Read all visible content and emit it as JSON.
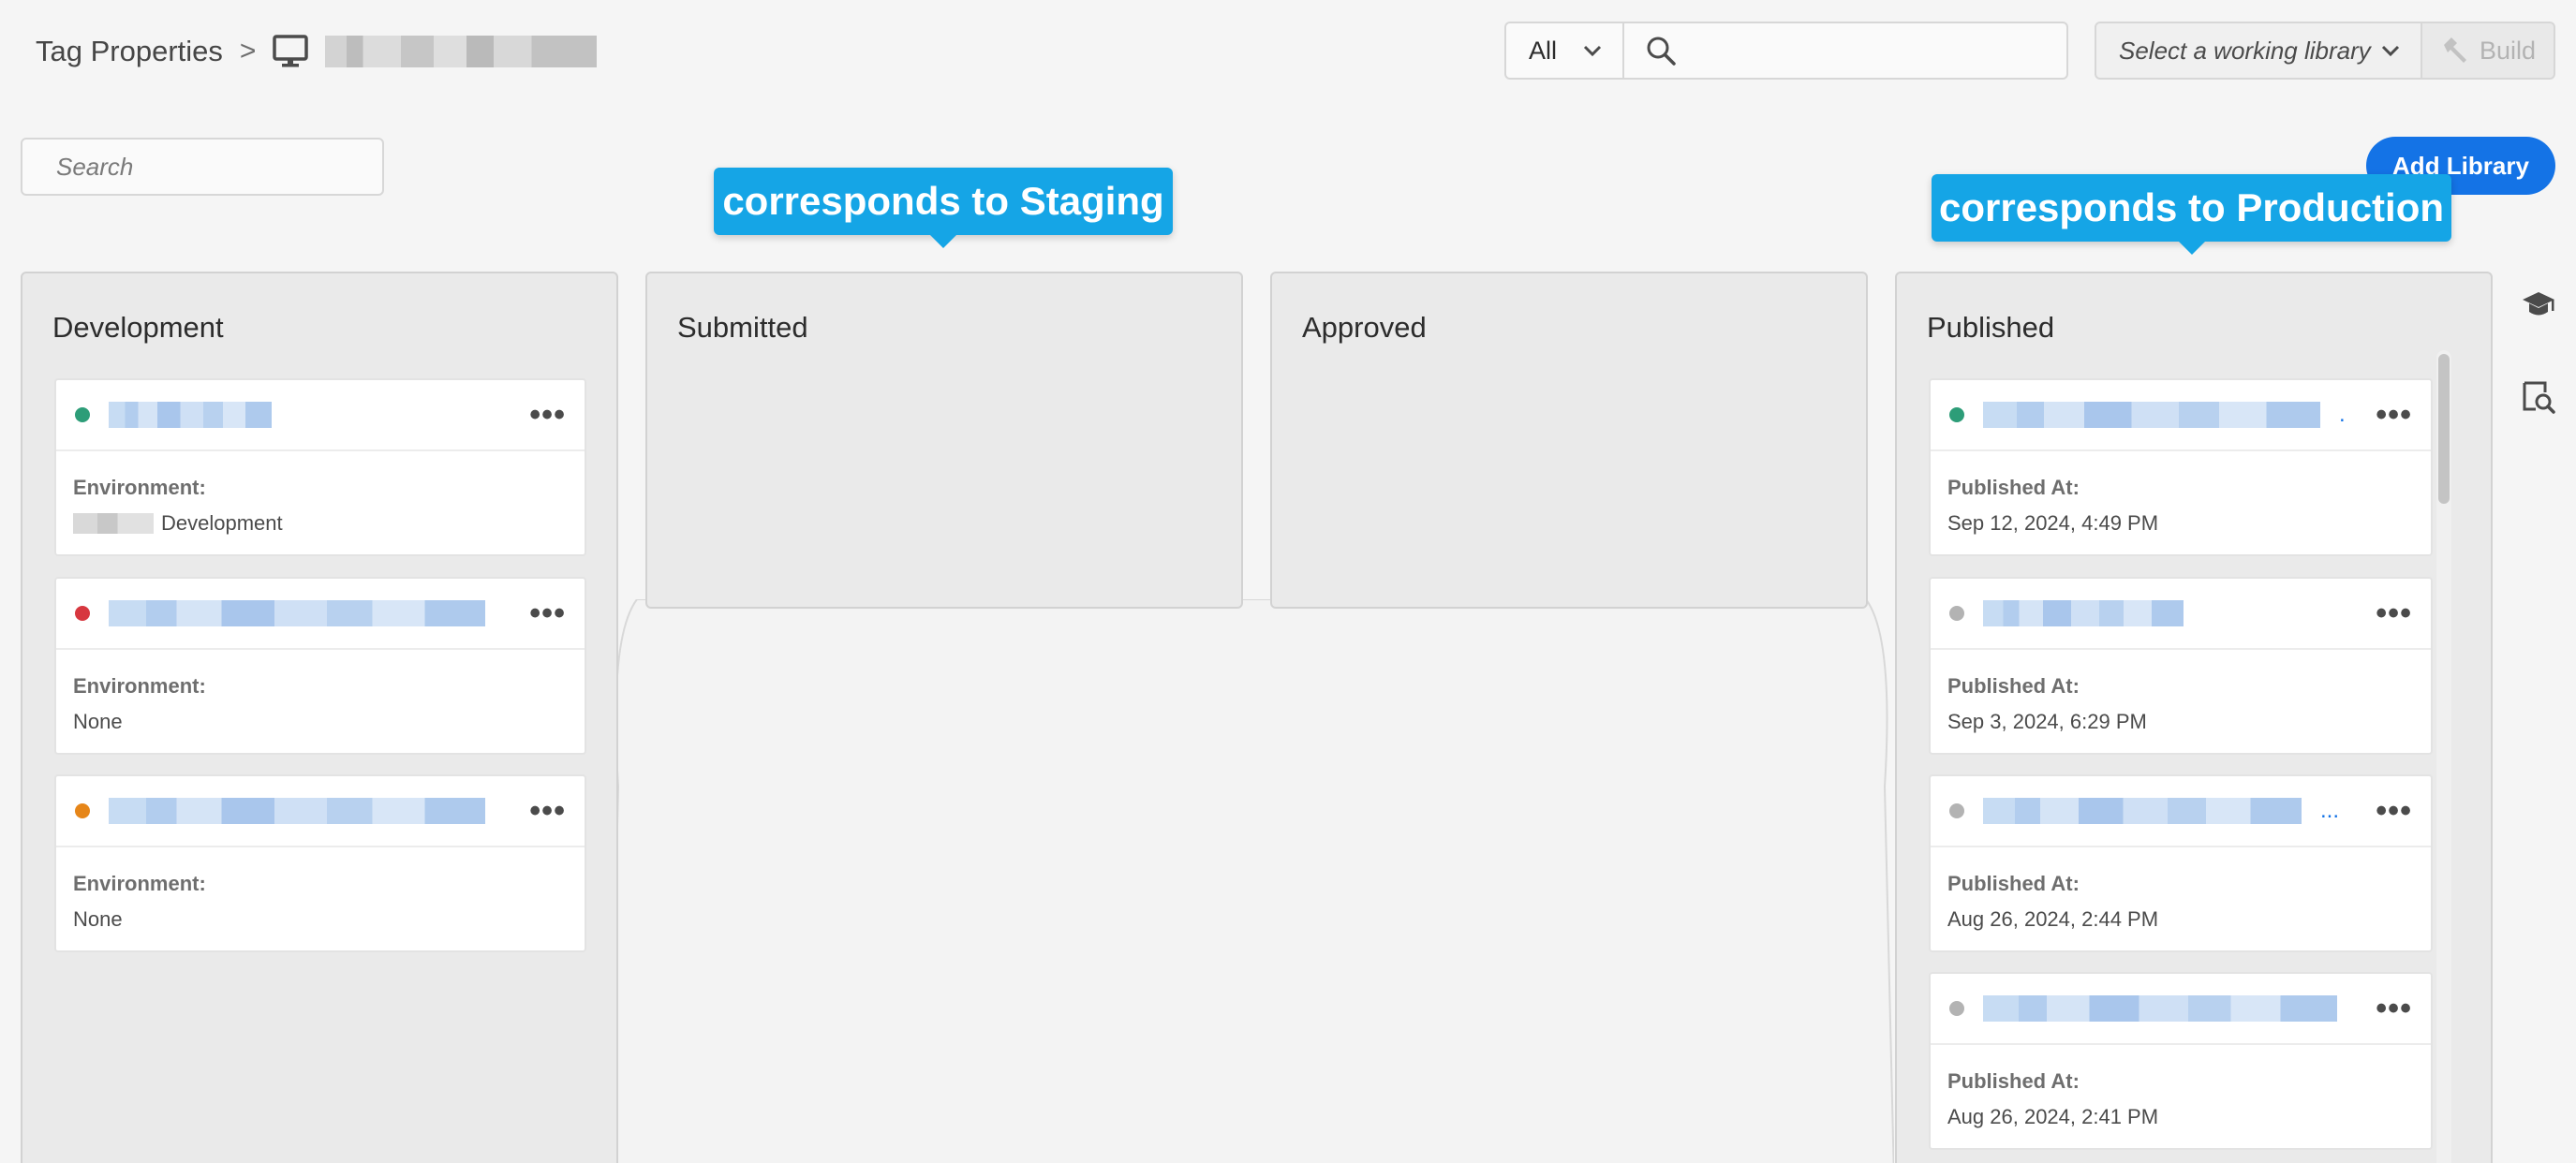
{
  "header": {
    "breadcrumb_root": "Tag Properties",
    "breadcrumb_separator": ">",
    "scope_select": {
      "value": "All"
    },
    "search": {
      "value": "",
      "placeholder": ""
    },
    "library_select": {
      "value": "Select a working library"
    },
    "build_label": "Build"
  },
  "toolbar": {
    "search_placeholder": "Search",
    "add_library_label": "Add Library"
  },
  "callouts": {
    "staging": "corresponds to Staging",
    "production": "corresponds to Production"
  },
  "colors": {
    "accent": "#1473e6",
    "callout": "#15a5e6",
    "status_green": "#2d9d78",
    "status_red": "#d7373f",
    "status_orange": "#e68619",
    "status_gray": "#b3b3b3"
  },
  "columns": {
    "development": {
      "title": "Development",
      "cards": [
        {
          "status": "green",
          "label": "Environment:",
          "value": "Development"
        },
        {
          "status": "red",
          "label": "Environment:",
          "value": "None"
        },
        {
          "status": "orange",
          "label": "Environment:",
          "value": "None"
        }
      ]
    },
    "submitted": {
      "title": "Submitted"
    },
    "approved": {
      "title": "Approved"
    },
    "published": {
      "title": "Published",
      "cards": [
        {
          "status": "green",
          "label": "Published At:",
          "value": "Sep 12, 2024, 4:49 PM",
          "truncation": "."
        },
        {
          "status": "gray",
          "label": "Published At:",
          "value": "Sep 3, 2024, 6:29 PM"
        },
        {
          "status": "gray",
          "label": "Published At:",
          "value": "Aug 26, 2024, 2:44 PM",
          "truncation": "..."
        },
        {
          "status": "gray",
          "label": "Published At:",
          "value": "Aug 26, 2024, 2:41 PM"
        }
      ]
    }
  },
  "icons": {
    "breadcrumb": "monitor-icon",
    "search": "search-icon",
    "build": "hammer-icon",
    "rail_top": "graduation-cap-icon",
    "rail_bottom": "search-document-icon",
    "card_menu": "more-icon"
  }
}
